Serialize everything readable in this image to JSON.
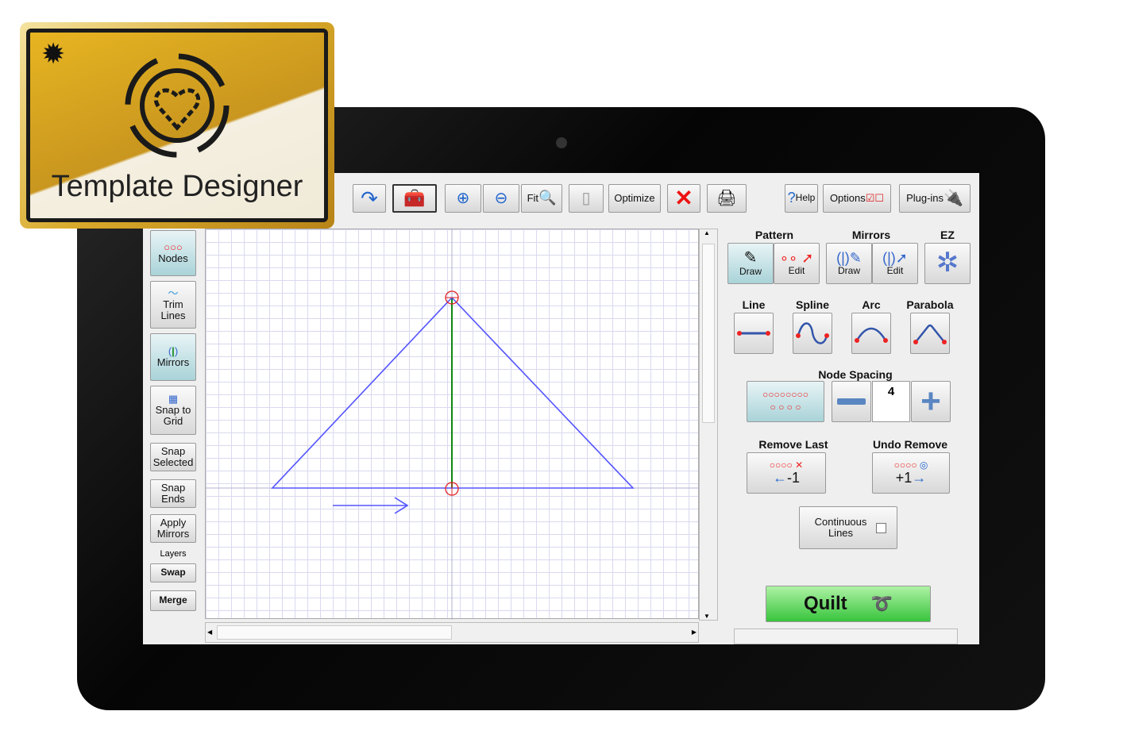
{
  "badge": {
    "title": "Template Designer"
  },
  "toolbar": {
    "fit": "Fit",
    "optimize": "Optimize",
    "help": "Help",
    "options": "Options",
    "plugins": "Plug-ins"
  },
  "sidebar": {
    "nodes": "Nodes",
    "trim": "Trim Lines",
    "mirrors": "Mirrors",
    "snap_grid": "Snap to Grid",
    "snap_selected": "Snap Selected",
    "snap_ends": "Snap Ends",
    "apply_mirrors": "Apply Mirrors",
    "layers": "Layers",
    "swap": "Swap",
    "merge": "Merge"
  },
  "panel": {
    "pattern": "Pattern",
    "mirrors": "Mirrors",
    "ez": "EZ",
    "draw": "Draw",
    "edit": "Edit",
    "line": "Line",
    "spline": "Spline",
    "arc": "Arc",
    "parabola": "Parabola",
    "node_spacing": "Node Spacing",
    "node_spacing_value": "4",
    "remove_last": "Remove Last",
    "remove_last_badge": "-1",
    "undo_remove": "Undo Remove",
    "undo_remove_badge": "+1",
    "continuous": "Continuous Lines",
    "quilt": "Quilt"
  },
  "colors": {
    "shape": "#5555ff",
    "mirror_axis": "#118811",
    "node": "#e02020"
  }
}
